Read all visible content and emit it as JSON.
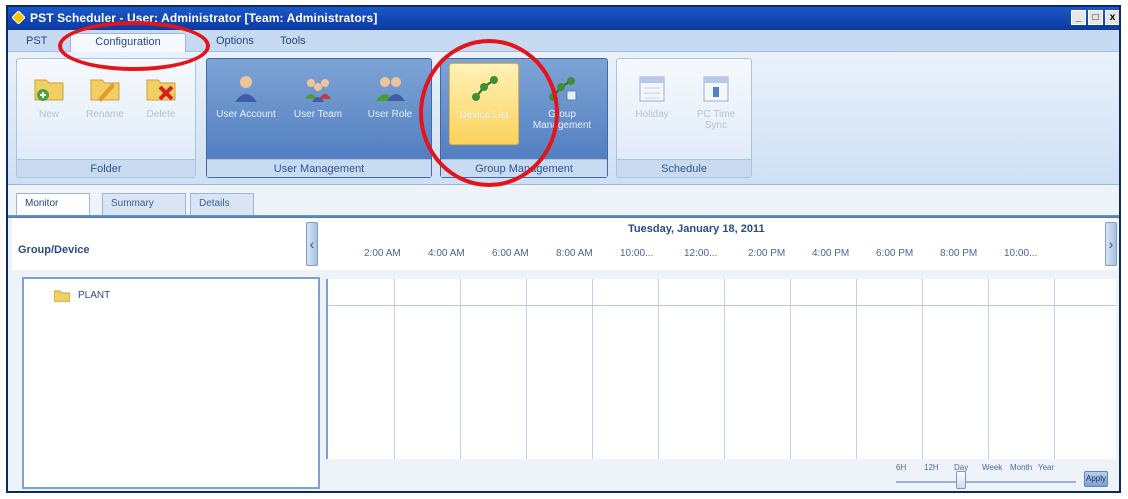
{
  "window": {
    "title": "PST Scheduler - User: Administrator [Team: Administrators]",
    "controls": {
      "minimize": "_",
      "maximize": "□",
      "close": "x"
    }
  },
  "menu": {
    "tabs": [
      {
        "label": "PST"
      },
      {
        "label": "Configuration",
        "active": true
      },
      {
        "label": "Options"
      },
      {
        "label": "Tools"
      }
    ]
  },
  "ribbon": {
    "groups": [
      {
        "label": "Folder",
        "buttons": [
          "New",
          "Rename",
          "Delete"
        ],
        "icons": [
          "add-folder-icon",
          "rename-folder-icon",
          "delete-folder-icon"
        ]
      },
      {
        "label": "User Management",
        "buttons": [
          "User Account",
          "User Team",
          "User Role"
        ],
        "icons": [
          "user-account-icon",
          "user-team-icon",
          "user-role-icon"
        ]
      },
      {
        "label": "Group Management",
        "buttons": [
          "Device List",
          "Group Management"
        ],
        "icons": [
          "device-list-icon",
          "group-management-icon"
        ]
      },
      {
        "label": "Schedule",
        "buttons": [
          "Holiday",
          "PC Time Sync"
        ],
        "icons": [
          "holiday-calendar-icon",
          "time-sync-icon"
        ]
      }
    ]
  },
  "subtabs": [
    {
      "label": "Monitor",
      "active": true
    },
    {
      "label": "Summary"
    },
    {
      "label": "Details"
    }
  ],
  "scheduler": {
    "group_device_label": "Group/Device",
    "date": "Tuesday, January 18, 2011",
    "time_labels": [
      "2:00 AM",
      "4:00 AM",
      "6:00 AM",
      "8:00 AM",
      "10:00...",
      "12:00...",
      "2:00 PM",
      "4:00 PM",
      "6:00 PM",
      "8:00 PM",
      "10:00..."
    ],
    "tree": [
      {
        "label": "PLANT",
        "icon": "folder-icon"
      }
    ],
    "zoom_levels": [
      "6H",
      "12H",
      "Day",
      "Week",
      "Month",
      "Year"
    ],
    "zoom_selected": "Day",
    "apply_label": "Apply"
  },
  "annotation_color": "#e3141a"
}
